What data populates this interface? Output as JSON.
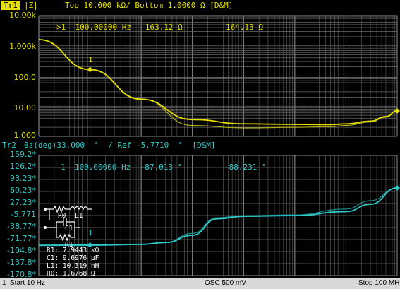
{
  "trace1": {
    "tag": "Tr1",
    "format": "|Z|",
    "scale_text": "Top 10.000 kΩ/ Bottom 1.0000 Ω [D&M]",
    "marker_line": ">1  100.00000 Hz   163.12 Ω",
    "marker_extra": "164.13 Ω",
    "marker_label": "1",
    "color": "#e6df00",
    "y_ticks": [
      "10.00k",
      "1.000k",
      "100.0",
      "10.00",
      "1.000"
    ]
  },
  "trace2": {
    "tag": "Tr2",
    "header_text": "θz(deg)33.000  °  / Ref -5.7710  °  [D&M]",
    "marker_line": "1  100.00000 Hz  -87.013 °",
    "marker_extra": "-88.231 °",
    "marker_label": "1",
    "color": "#2fc9c9",
    "y_ticks": [
      "159.2*",
      "126.2*",
      "93.23*",
      "60.23*",
      "27.23*",
      "-5.771",
      "-38.77*",
      "-71.77*",
      "-104.8*",
      "-137.8*",
      "-170.8*"
    ]
  },
  "equivalent_circuit": {
    "labels": [
      "R0",
      "L1",
      "C1",
      "R1"
    ],
    "values": [
      "R1: 7.9443 kΩ",
      "C1: 9.6976 µF",
      "L1: 10.319 nH",
      "R0: 1.6768 Ω"
    ]
  },
  "footer": {
    "channel": "1",
    "start": "Start 10 Hz",
    "osc": "OSC 500 mV",
    "stop": "Stop 100 MH"
  },
  "chart_data": [
    {
      "type": "line",
      "x_scale": "log",
      "xlim": [
        10,
        100000000
      ],
      "y_scale": "log",
      "ylim": [
        1,
        10000
      ],
      "grid": true,
      "series": [
        {
          "x": [
            10,
            100,
            1000,
            10000,
            100000,
            1000000,
            5000000,
            10000000,
            30000000,
            60000000,
            100000000
          ],
          "values": [
            1600,
            163.12,
            17,
            3.6,
            2.6,
            2.5,
            2.45,
            2.6,
            3.2,
            4.5,
            7
          ]
        },
        {
          "x": [
            10,
            100,
            1000,
            10000,
            100000,
            1000000,
            5000000,
            10000000,
            30000000,
            60000000,
            100000000
          ],
          "values": [
            1600,
            164.13,
            17.5,
            2.3,
            1.9,
            2.0,
            2.1,
            2.3,
            3.0,
            4.3,
            7
          ]
        }
      ]
    },
    {
      "type": "line",
      "x_scale": "log",
      "xlim": [
        10,
        100000000
      ],
      "y_scale": "linear",
      "ylim": [
        -170.8,
        159.2
      ],
      "grid": true,
      "series": [
        {
          "x": [
            10,
            100,
            1000,
            3000,
            10000,
            30000,
            100000,
            1000000,
            10000000,
            30000000,
            100000000
          ],
          "values": [
            -87.5,
            -87.013,
            -85,
            -80,
            -60,
            -15,
            -8,
            -6,
            5,
            25,
            70
          ]
        },
        {
          "x": [
            10,
            100,
            1000,
            3000,
            10000,
            30000,
            100000,
            1000000,
            10000000,
            30000000,
            100000000
          ],
          "values": [
            -88.5,
            -88.231,
            -86,
            -80,
            -55,
            -12,
            -6,
            -4,
            12,
            35,
            70
          ]
        }
      ]
    }
  ]
}
